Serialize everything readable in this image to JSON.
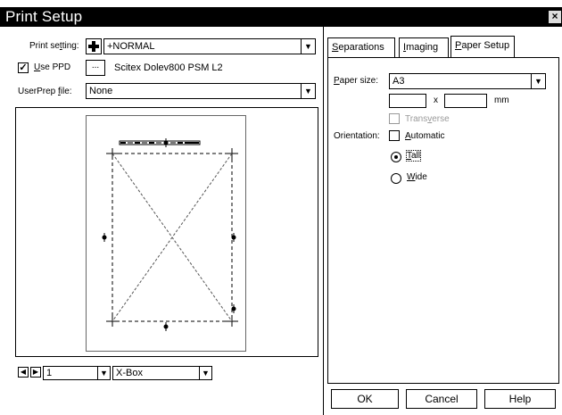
{
  "window": {
    "title": "Print Setup",
    "close_glyph": "×"
  },
  "left": {
    "print_setting": {
      "label_pre": "Print se",
      "label_u": "t",
      "label_post": "ting:",
      "value": "+NORMAL"
    },
    "use_ppd": {
      "checked": true,
      "label_u": "U",
      "label_post": "se PPD",
      "browse_label": "...",
      "value": "Scitex Dolev800 PSM L2"
    },
    "userprep": {
      "label_pre": "UserPrep ",
      "label_u": "f",
      "label_post": "ile:",
      "value": "None"
    },
    "bottom": {
      "page_value": "1",
      "mark_value": "X-Box"
    }
  },
  "right": {
    "tabs": [
      {
        "label_u": "S",
        "label_post": "eparations"
      },
      {
        "label_u": "I",
        "label_post": "maging"
      },
      {
        "label_u": "P",
        "label_post": "aper Setup"
      }
    ],
    "paper_size": {
      "label_u": "P",
      "label_post": "aper size:",
      "value": "A3"
    },
    "dimensions": {
      "x_label": "x",
      "unit": "mm"
    },
    "transverse": {
      "label_pre": "Trans",
      "label_u": "v",
      "label_post": "erse"
    },
    "orientation": {
      "label": "Orientation:",
      "automatic": {
        "label_u": "A",
        "label_post": "utomatic"
      },
      "tall": {
        "label_u": "T",
        "label_post": "all"
      },
      "wide": {
        "label_u": "W",
        "label_post": "ide"
      }
    },
    "buttons": {
      "ok": "OK",
      "cancel": "Cancel",
      "help": "Help"
    }
  },
  "icons": [
    "plus-icon",
    "dropdown-arrow-icon",
    "checkmark-icon",
    "first-page-icon",
    "next-page-icon",
    "registration-mark-icon"
  ]
}
